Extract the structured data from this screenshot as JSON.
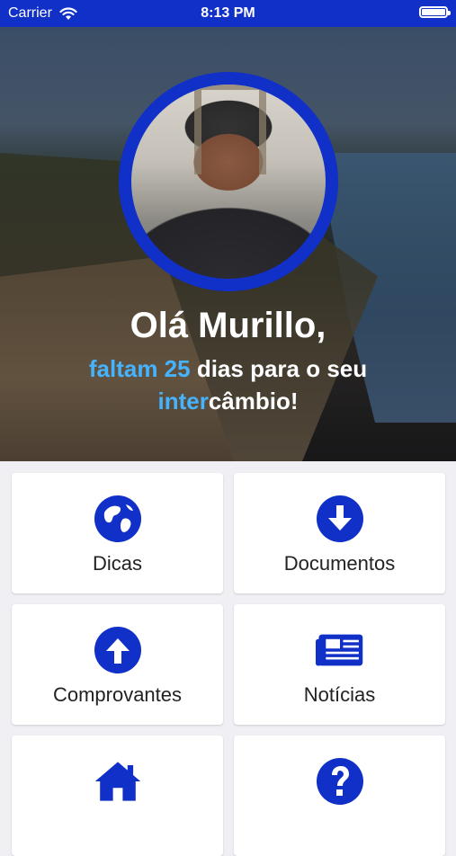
{
  "status_bar": {
    "carrier": "Carrier",
    "time": "8:13 PM",
    "icons": [
      "wifi-icon",
      "battery-icon"
    ]
  },
  "header": {
    "greeting": "Olá Murillo,",
    "countdown_prefix": "faltam",
    "countdown_days": "25",
    "countdown_middle": "dias para o seu",
    "countdown_highlight": "inter",
    "countdown_suffix": "câmbio!"
  },
  "menu": {
    "items": [
      {
        "label": "Dicas",
        "icon": "globe-icon"
      },
      {
        "label": "Documentos",
        "icon": "download-circle-icon"
      },
      {
        "label": "Comprovantes",
        "icon": "upload-circle-icon"
      },
      {
        "label": "Notícias",
        "icon": "newspaper-icon"
      },
      {
        "label": "",
        "icon": "home-icon"
      },
      {
        "label": "",
        "icon": "question-circle-icon"
      }
    ]
  },
  "colors": {
    "primary": "#1030c8",
    "highlight": "#46b3ff",
    "background": "#efeff4"
  }
}
